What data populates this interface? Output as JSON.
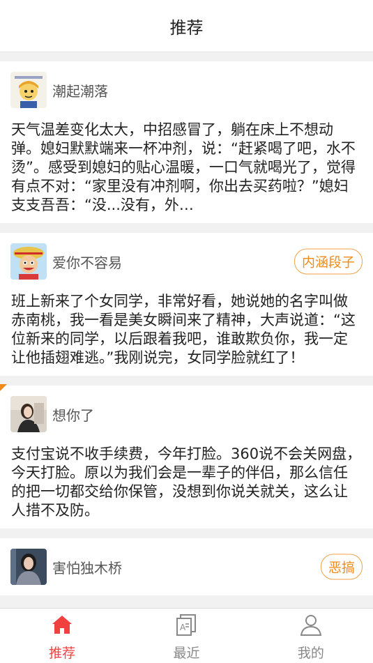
{
  "header": {
    "title": "推荐"
  },
  "feed": [
    {
      "author": "潮起潮落",
      "avatar": "cartoon-boy-avatar",
      "tag": "",
      "text": "天气温差变化太大，中招感冒了，躺在床上不想动弹。媳妇默默端来一杯冲剂，说：“赶紧喝了吧，水不烫”。感受到媳妇的贴心温暖，一口气就喝光了，觉得有点不对：“家里没有冲剂啊，你出去买药啦？”媳妇支支吾吾：“没...没有，外…"
    },
    {
      "author": "爱你不容易",
      "avatar": "one-piece-luffy-avatar",
      "tag": "内涵段子",
      "text": "班上新来了个女同学，非常好看，她说她的名字叫做赤南桃，我一看是美女瞬间来了精神，大声说道：“这位新来的同学，以后跟着我吧，谁敢欺负你，我一定让他插翅难逃。”我刚说完，女同学脸就红了！"
    },
    {
      "author": "想你了",
      "avatar": "woman-photo-avatar",
      "tag": "",
      "text": "支付宝说不收手续费，今年打脸。360说不会关网盘，今天打脸。原以为我们会是一辈子的伴侣，那么信任的把一切都交给你保管，没想到你说关就关，这么让人措不及防。"
    },
    {
      "author": "害怕独木桥",
      "avatar": "woman-selfie-avatar",
      "tag": "恶搞",
      "text": ""
    }
  ],
  "tabbar": [
    {
      "label": "推荐",
      "icon": "home-icon",
      "active": true
    },
    {
      "label": "最近",
      "icon": "recent-document-icon",
      "active": false
    },
    {
      "label": "我的",
      "icon": "user-profile-icon",
      "active": false
    }
  ],
  "colors": {
    "accent": "#f04040",
    "tag_border": "#f0a24a",
    "tag_text": "#f08a1a",
    "background": "#f1f1f1"
  }
}
